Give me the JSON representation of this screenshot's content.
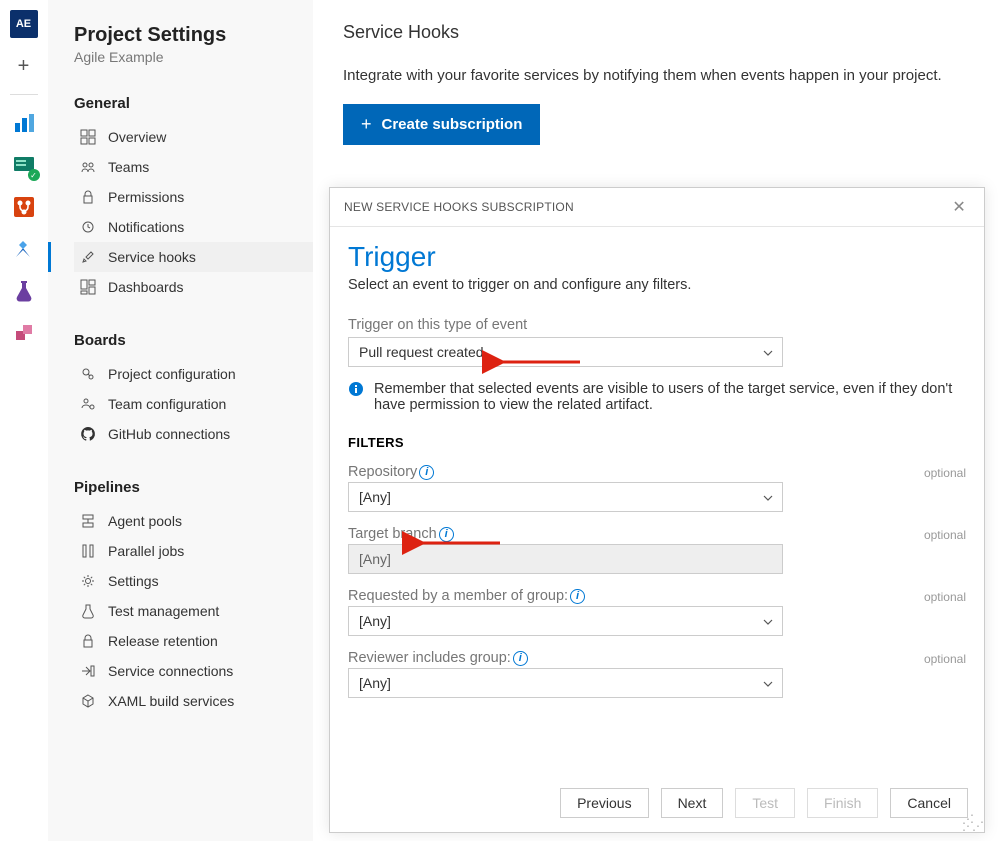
{
  "rail": {
    "project_initials": "AE"
  },
  "sidebar": {
    "title": "Project Settings",
    "subtitle": "Agile Example",
    "sections": [
      {
        "title": "General",
        "items": [
          {
            "icon": "overview-icon",
            "label": "Overview"
          },
          {
            "icon": "teams-icon",
            "label": "Teams"
          },
          {
            "icon": "permissions-icon",
            "label": "Permissions"
          },
          {
            "icon": "notifications-icon",
            "label": "Notifications"
          },
          {
            "icon": "service-hooks-icon",
            "label": "Service hooks",
            "active": true
          },
          {
            "icon": "dashboards-icon",
            "label": "Dashboards"
          }
        ]
      },
      {
        "title": "Boards",
        "items": [
          {
            "icon": "project-config-icon",
            "label": "Project configuration"
          },
          {
            "icon": "team-config-icon",
            "label": "Team configuration"
          },
          {
            "icon": "github-icon",
            "label": "GitHub connections"
          }
        ]
      },
      {
        "title": "Pipelines",
        "items": [
          {
            "icon": "agent-pools-icon",
            "label": "Agent pools"
          },
          {
            "icon": "parallel-jobs-icon",
            "label": "Parallel jobs"
          },
          {
            "icon": "settings-icon",
            "label": "Settings"
          },
          {
            "icon": "test-mgmt-icon",
            "label": "Test management"
          },
          {
            "icon": "release-retention-icon",
            "label": "Release retention"
          },
          {
            "icon": "service-conn-icon",
            "label": "Service connections"
          },
          {
            "icon": "xaml-icon",
            "label": "XAML build services"
          }
        ]
      }
    ]
  },
  "main": {
    "title": "Service Hooks",
    "description": "Integrate with your favorite services by notifying them when events happen in your project.",
    "create_label": "Create subscription"
  },
  "dialog": {
    "header": "NEW SERVICE HOOKS SUBSCRIPTION",
    "title": "Trigger",
    "subtitle": "Select an event to trigger on and configure any filters.",
    "event_label": "Trigger on this type of event",
    "event_value": "Pull request created",
    "info_text": "Remember that selected events are visible to users of the target service, even if they don't have permission to view the related artifact.",
    "filters_heading": "FILTERS",
    "optional_label": "optional",
    "filters": [
      {
        "label": "Repository",
        "value": "[Any]",
        "info": true,
        "disabled": false
      },
      {
        "label": "Target branch",
        "value": "[Any]",
        "info": true,
        "disabled": true
      },
      {
        "label": "Requested by a member of group:",
        "value": "[Any]",
        "info": true,
        "disabled": false
      },
      {
        "label": "Reviewer includes group:",
        "value": "[Any]",
        "info": true,
        "disabled": false
      }
    ],
    "buttons": {
      "previous": "Previous",
      "next": "Next",
      "test": "Test",
      "finish": "Finish",
      "cancel": "Cancel"
    }
  }
}
